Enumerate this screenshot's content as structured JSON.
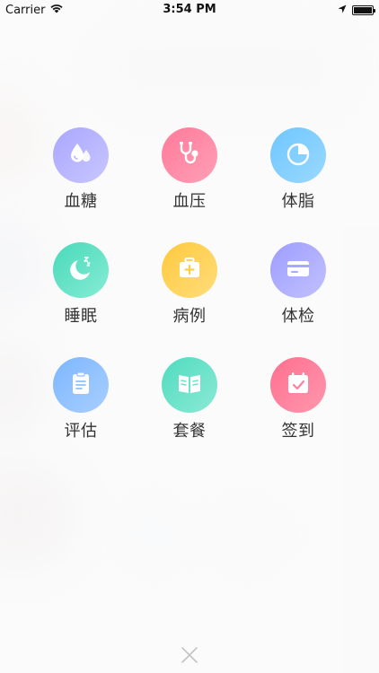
{
  "status_bar": {
    "carrier": "Carrier",
    "time": "3:54 PM"
  },
  "menu": {
    "items": [
      {
        "label": "血糖",
        "icon": "blood-drop-icon",
        "color_from": "#a9a7ff",
        "color_to": "#c9c6ff"
      },
      {
        "label": "血压",
        "icon": "stethoscope-icon",
        "color_from": "#ff7a9a",
        "color_to": "#ff9fb6"
      },
      {
        "label": "体脂",
        "icon": "pie-chart-icon",
        "color_from": "#6fc6ff",
        "color_to": "#9ad9ff"
      },
      {
        "label": "睡眠",
        "icon": "moon-icon",
        "color_from": "#49d9b9",
        "color_to": "#86ecd5"
      },
      {
        "label": "病例",
        "icon": "medical-kit-icon",
        "color_from": "#ffc93e",
        "color_to": "#ffdd7a"
      },
      {
        "label": "体检",
        "icon": "card-icon",
        "color_from": "#9d9dff",
        "color_to": "#c2c1ff"
      },
      {
        "label": "评估",
        "icon": "clipboard-icon",
        "color_from": "#7cb6ff",
        "color_to": "#a9cfff"
      },
      {
        "label": "套餐",
        "icon": "book-icon",
        "color_from": "#4fdcbf",
        "color_to": "#8ce9d5"
      },
      {
        "label": "签到",
        "icon": "calendar-check-icon",
        "color_from": "#ff6f8f",
        "color_to": "#ff97ad"
      }
    ]
  },
  "close": {
    "icon": "close-icon",
    "color": "#c4c4c4"
  }
}
